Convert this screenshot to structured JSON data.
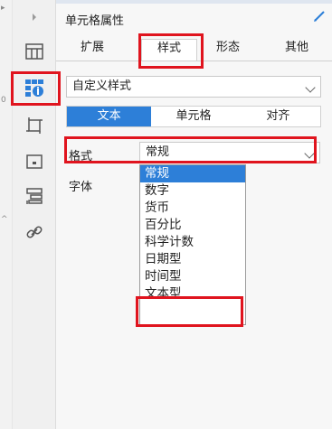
{
  "panel": {
    "title": "单元格属性",
    "tabs": [
      "扩展",
      "样式",
      "形态",
      "其他"
    ],
    "active_tab": "样式"
  },
  "style_select": {
    "value": "自定义样式"
  },
  "subtabs": [
    "文本",
    "单元格",
    "对齐"
  ],
  "active_subtab": "文本",
  "format": {
    "label": "格式",
    "value": "常规",
    "options": [
      "常规",
      "数字",
      "货币",
      "百分比",
      "科学计数",
      "日期型",
      "时间型",
      "文本型"
    ],
    "selected": "常规"
  },
  "font": {
    "label": "字体"
  },
  "left_strip": {
    "marks": [
      "0",
      "^"
    ]
  },
  "colors": {
    "accent": "#2d7fd8",
    "highlight": "#e0141e"
  }
}
